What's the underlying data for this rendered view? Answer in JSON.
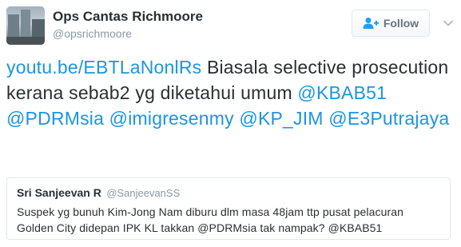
{
  "author": {
    "name": "Ops Cantas Richmoore",
    "handle": "@opsrichmoore",
    "avatar_icon": "city-buildings-avatar"
  },
  "follow_button": {
    "label": "Follow",
    "icon": "add-user-icon"
  },
  "menu_icon": "chevron-down-icon",
  "tweet": {
    "link": "youtu.be/EBTLaNonlRs",
    "text": " Biasala selective prosecution kerana sebab2 yg diketahui umum ",
    "mentions": [
      "@KBAB51",
      "@PDRMsia",
      "@imigresenmy",
      "@KP_JIM",
      "@E3Putrajaya"
    ]
  },
  "quoted_tweet": {
    "name": "Sri Sanjeevan R",
    "handle": "@SanjeevanSS",
    "text": "Suspek yg bunuh Kim-Jong Nam diburu dlm masa 48jam ttp pusat pelacuran Golden City didepan IPK KL takkan @PDRMsia tak nampak? @KBAB51"
  },
  "colors": {
    "link": "#1b95e0",
    "text": "#292f33",
    "muted": "#8899a6",
    "border": "#e1e8ed"
  }
}
